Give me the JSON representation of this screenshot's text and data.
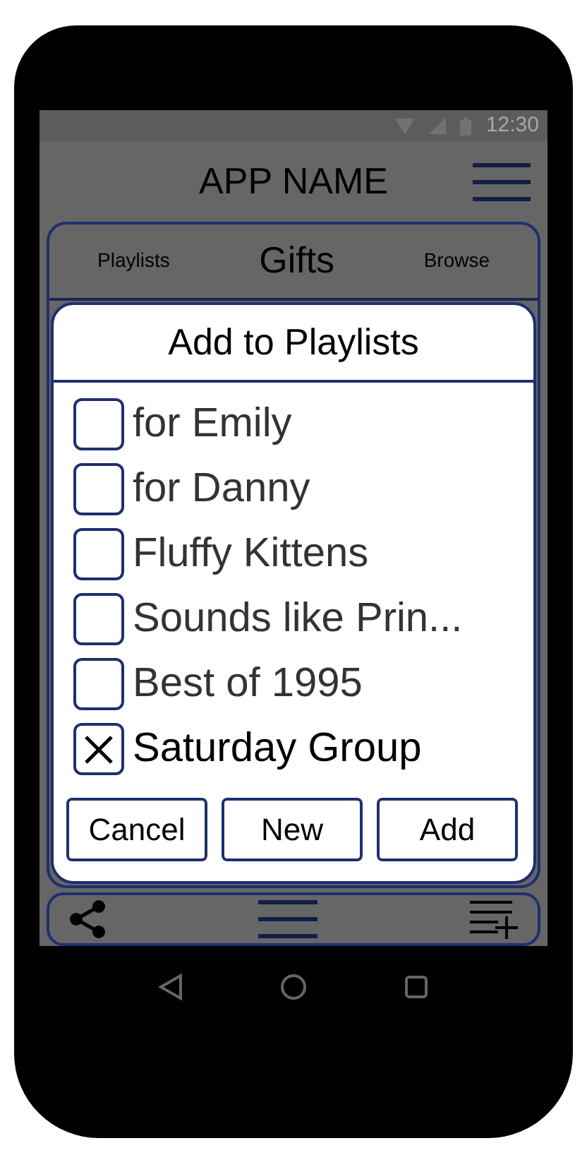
{
  "status_bar": {
    "time": "12:30"
  },
  "app_bar": {
    "title": "APP NAME"
  },
  "header": {
    "left_tab": "Playlists",
    "title": "Gifts",
    "right_tab": "Browse"
  },
  "dialog": {
    "title": "Add to Playlists",
    "items": [
      {
        "label": "for Emily",
        "checked": false
      },
      {
        "label": "for Danny",
        "checked": false
      },
      {
        "label": "Fluffy Kittens",
        "checked": false
      },
      {
        "label": "Sounds like Prin...",
        "checked": false
      },
      {
        "label": "Best of 1995",
        "checked": false
      },
      {
        "label": "Saturday Group",
        "checked": true
      }
    ],
    "buttons": [
      "Cancel",
      "New",
      "Add"
    ]
  }
}
